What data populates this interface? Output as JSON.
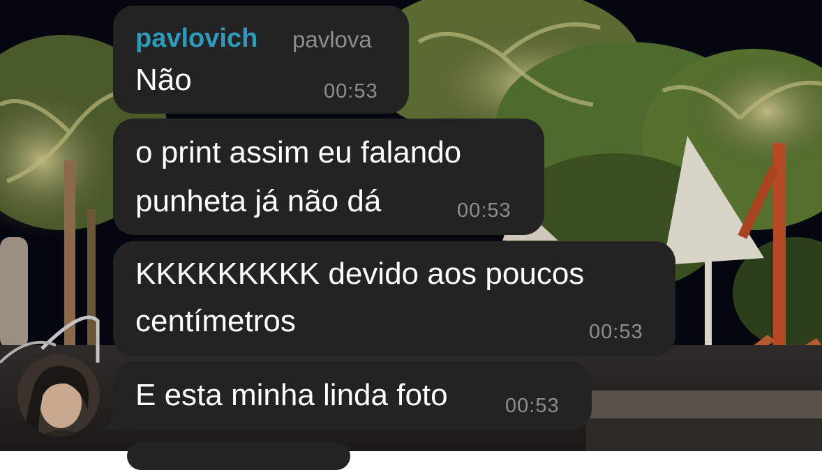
{
  "chat": {
    "messages": [
      {
        "sender_name": "pavlovich",
        "sender_handle": "pavlova",
        "text_lines": [
          "Não"
        ],
        "time": "00:53"
      },
      {
        "text_lines": [
          "o print assim eu falando",
          "punheta já não dá"
        ],
        "time": "00:53"
      },
      {
        "text_lines": [
          "KKKKKKKKK devido aos poucos",
          "centímetros"
        ],
        "time": "00:53"
      },
      {
        "text_lines": [
          "E esta minha linda foto"
        ],
        "time": "00:53"
      }
    ]
  },
  "colors": {
    "bubble": "#232323",
    "sender_name": "#2e9bbd",
    "time": "#8d8d8d",
    "text": "#ffffff"
  },
  "icons": {
    "avatar": "user-avatar-photo"
  }
}
